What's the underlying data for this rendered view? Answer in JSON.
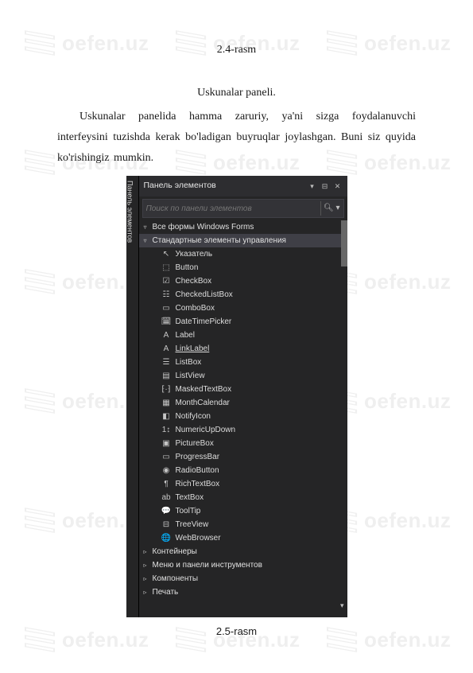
{
  "watermark": "oefen.uz",
  "figure_top": "2.4-rasm",
  "subtitle": "Uskunalar paneli.",
  "paragraph": "Uskunalar panelida hamma zaruriy, ya'ni sizga foydalanuvchi interfeysini tuzishda kerak bo'ladigan buyruqlar joylashgan. Buni siz quyida ko'rishingiz mumkin.",
  "figure_bottom": "2.5-rasm",
  "toolbox": {
    "side_tab": "Панель элементов",
    "title": "Панель элементов",
    "search_placeholder": "Поиск по панели элементов",
    "groups": [
      {
        "expanded": true,
        "level": 1,
        "label": "Все формы Windows Forms"
      },
      {
        "expanded": true,
        "level": 1,
        "label": "Стандартные элементы управления",
        "highlight": true
      }
    ],
    "items": [
      {
        "icon": "cursor",
        "label": "Указатель"
      },
      {
        "icon": "button",
        "label": "Button"
      },
      {
        "icon": "check",
        "label": "CheckBox"
      },
      {
        "icon": "checklist",
        "label": "CheckedListBox"
      },
      {
        "icon": "combo",
        "label": "ComboBox"
      },
      {
        "icon": "date",
        "label": "DateTimePicker"
      },
      {
        "icon": "label",
        "label": "Label"
      },
      {
        "icon": "linklabel",
        "label": "LinkLabel"
      },
      {
        "icon": "listbox",
        "label": "ListBox"
      },
      {
        "icon": "listview",
        "label": "ListView"
      },
      {
        "icon": "masked",
        "label": "MaskedTextBox"
      },
      {
        "icon": "month",
        "label": "MonthCalendar"
      },
      {
        "icon": "notify",
        "label": "NotifyIcon"
      },
      {
        "icon": "numeric",
        "label": "NumericUpDown"
      },
      {
        "icon": "picture",
        "label": "PictureBox"
      },
      {
        "icon": "progress",
        "label": "ProgressBar"
      },
      {
        "icon": "radio",
        "label": "RadioButton"
      },
      {
        "icon": "richtext",
        "label": "RichTextBox"
      },
      {
        "icon": "textbox",
        "label": "TextBox"
      },
      {
        "icon": "tooltip",
        "label": "ToolTip"
      },
      {
        "icon": "tree",
        "label": "TreeView"
      },
      {
        "icon": "web",
        "label": "WebBrowser"
      }
    ],
    "trailing_groups": [
      {
        "label": "Контейнеры"
      },
      {
        "label": "Меню и панели инструментов"
      },
      {
        "label": "Компоненты"
      },
      {
        "label": "Печать"
      }
    ]
  }
}
